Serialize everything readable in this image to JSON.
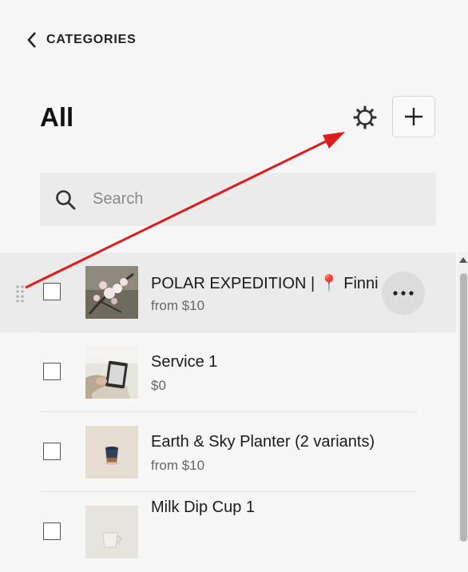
{
  "nav": {
    "back_label": "CATEGORIES",
    "back_icon": "chevron-left-icon"
  },
  "header": {
    "title": "All",
    "settings_icon": "gear-icon",
    "add_icon": "plus-icon"
  },
  "search": {
    "placeholder": "Search",
    "value": "",
    "icon": "search-icon"
  },
  "products": [
    {
      "name": "POLAR EXPEDITION | 📍 Finni",
      "price": "from $10",
      "selected": true,
      "checked": false,
      "thumbnail": "cherry-blossom-photo"
    },
    {
      "name": "Service 1",
      "price": "$0",
      "selected": false,
      "checked": false,
      "thumbnail": "reading-tablet-photo"
    },
    {
      "name": "Earth & Sky Planter (2 variants)",
      "price": "from $10",
      "selected": false,
      "checked": false,
      "thumbnail": "planter-photo"
    },
    {
      "name": "Milk Dip Cup 1",
      "price": "",
      "selected": false,
      "checked": false,
      "thumbnail": "cup-photo"
    }
  ],
  "row_actions": {
    "more_icon": "more-horizontal-icon",
    "drag_icon": "drag-handle-icon"
  },
  "colors": {
    "annotation_arrow": "#e01b1b",
    "selected_row": "#ebebeb",
    "search_bg": "#ececec"
  }
}
